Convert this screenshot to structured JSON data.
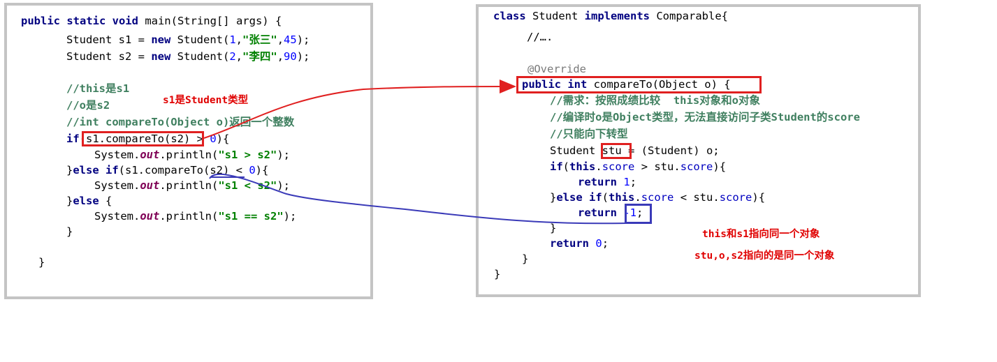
{
  "left_code": {
    "l1_kw": "public static void",
    "l1_rest": " main(String[] args) {",
    "l2_pre": "Student s1 = ",
    "l2_kw": "new",
    "l2_mid": " Student(",
    "l2_n1": "1",
    "l2_c1": ",",
    "l2_str": "\"张三\"",
    "l2_c2": ",",
    "l2_n2": "45",
    "l2_end": ");",
    "l3_pre": "Student s2 = ",
    "l3_kw": "new",
    "l3_mid": " Student(",
    "l3_n1": "2",
    "l3_c1": ",",
    "l3_str": "\"李四\"",
    "l3_c2": ",",
    "l3_n2": "90",
    "l3_end": ");",
    "c1": "//this是s1",
    "c2": "//o是s2",
    "c3": "//int compareTo(Object o)返回一个整数",
    "if_kw": "if",
    "if_mid": "(s1.compareTo(s2) > ",
    "if_num": "0",
    "if_end": "){",
    "p1_a": "System.",
    "p1_out": "out",
    "p1_b": ".println(",
    "p1_str": "\"s1 > s2\"",
    "p1_end": ");",
    "elif_a": "}",
    "elif_kw": "else if",
    "elif_mid": "(s1.compareTo(s2) < ",
    "elif_num": "0",
    "elif_end": "){",
    "p2_a": "System.",
    "p2_out": "out",
    "p2_b": ".println(",
    "p2_str": "\"s1 < s2\"",
    "p2_end": ");",
    "else_a": "}",
    "else_kw": "else",
    "else_end": " {",
    "p3_a": "System.",
    "p3_out": "out",
    "p3_b": ".println(",
    "p3_str": "\"s1 == s2\"",
    "p3_end": ");",
    "close1": "}",
    "close2": "}"
  },
  "right_code": {
    "cls_kw": "class",
    "cls_name": " Student ",
    "cls_kw2": "implements",
    "cls_end": " Comparable{",
    "dots": "//….",
    "override": "@Override",
    "m_kw": "public int",
    "m_rest": " compareTo(Object o) {",
    "c1": "//需求：按照成绩比较  this对象和o对象",
    "c2": "//编译时o是Object类型，无法直接访问子类Student的score",
    "c3": "//只能向下转型",
    "cast_a": "Student stu = (Student) o;",
    "if_kw": "if",
    "if_a": "(",
    "if_this": "this",
    "if_b": ".",
    "if_score1": "score",
    "if_c": " > stu.",
    "if_score2": "score",
    "if_end": "){",
    "r1_kw": "return",
    "r1_sp": " ",
    "r1_num": "1",
    "r1_end": ";",
    "elif_a": "}",
    "elif_kw": "else if",
    "elif_b": "(",
    "elif_this": "this",
    "elif_c": ".",
    "elif_score1": "score",
    "elif_d": " < stu.",
    "elif_score2": "score",
    "elif_end": "){",
    "r2_kw": "return",
    "r2_sp": " ",
    "r2_num": "-1",
    "r2_end": ";",
    "close_if": "}",
    "r3_kw": "return",
    "r3_sp": " ",
    "r3_num": "0",
    "r3_end": ";",
    "close_m": "}",
    "close_c": "}"
  },
  "annotations": {
    "s1_type": "s1是Student类型",
    "this_s1": "this和s1指向同一个对象",
    "stu_o_s2": "stu,o,s2指向的是同一个对象"
  },
  "colors": {
    "keyword": "#000080",
    "string": "#008000",
    "number": "#0000ff",
    "comment": "#3f7f5f",
    "highlight_red": "#e02020",
    "highlight_blue": "#3a3ab8",
    "note_red": "#e00000",
    "panel_border": "#c4c4c4"
  }
}
